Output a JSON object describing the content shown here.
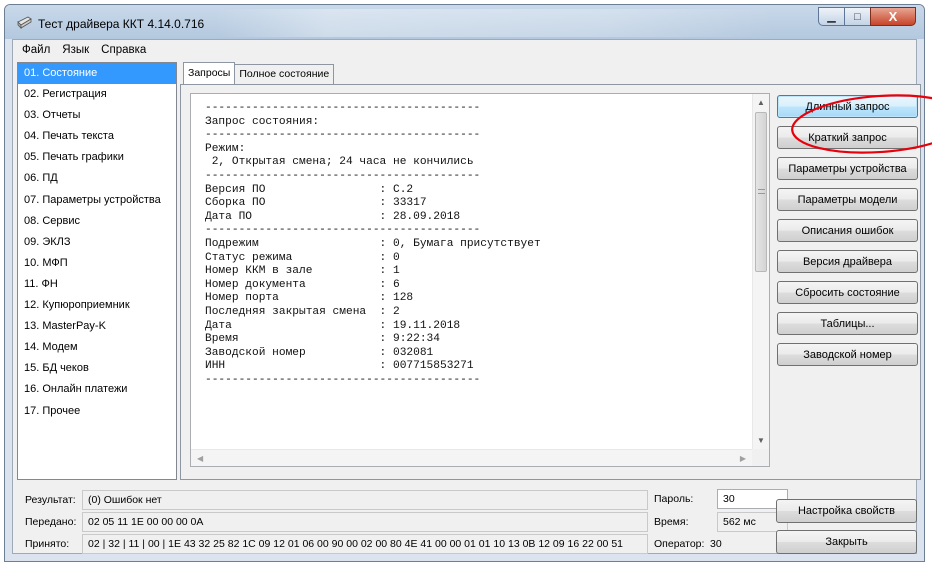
{
  "window": {
    "title": "Тест драйвера ККТ 4.14.0.716",
    "minimize_glyph": "▁",
    "maximize_glyph": "□",
    "close_glyph": "X"
  },
  "menu": [
    "Файл",
    "Язык",
    "Справка"
  ],
  "sidebar": {
    "items": [
      "01. Состояние",
      "02. Регистрация",
      "03. Отчеты",
      "04. Печать текста",
      "05. Печать графики",
      "06. ПД",
      "07. Параметры устройства",
      "08. Сервис",
      "09. ЭКЛЗ",
      "10. МФП",
      "11. ФН",
      "12. Купюроприемник",
      "13. MasterPay-K",
      "14. Модем",
      "15. БД чеков",
      "16. Онлайн платежи",
      "17. Прочее"
    ],
    "selected_index": 0
  },
  "tabs": [
    "Запросы",
    "Полное состояние"
  ],
  "output_text": [
    "-----------------------------------------",
    "Запрос состояния:",
    "-----------------------------------------",
    "Режим:",
    " 2, Открытая смена; 24 часа не кончились",
    "-----------------------------------------",
    "Версия ПО                 : C.2",
    "Сборка ПО                 : 33317",
    "Дата ПО                   : 28.09.2018",
    "-----------------------------------------",
    "Подрежим                  : 0, Бумага присутствует",
    "Статус режима             : 0",
    "Номер ККМ в зале          : 1",
    "Номер документа           : 6",
    "Номер порта               : 128",
    "Последняя закрытая смена  : 2",
    "Дата                      : 19.11.2018",
    "Время                     : 9:22:34",
    "Заводской номер           : 032081",
    "ИНН                       : 007715853271",
    "-----------------------------------------"
  ],
  "buttons": {
    "long_request": "Длинный запрос",
    "short_request": "Краткий запрос",
    "device_params": "Параметры устройства",
    "model_params": "Параметры модели",
    "error_descriptions": "Описания ошибок",
    "driver_version": "Версия драйвера",
    "reset_state": "Сбросить состояние",
    "tables": "Таблицы...",
    "serial_number": "Заводской номер",
    "settings": "Настройка свойств",
    "close": "Закрыть"
  },
  "status": {
    "result_label": "Результат:",
    "result_value": "(0) Ошибок нет",
    "sent_label": "Передано:",
    "sent_value": "02 05 11 1E 00 00 00 0A",
    "received_label": "Принято:",
    "received_value": "02 | 32 | 11 | 00 | 1E 43 32 25 82 1C 09 12 01 06 00 90 00 02 00 80 4E 41 00 00 01 01 10 13 0B 12 09 16 22 00 51",
    "password_label": "Пароль:",
    "password_value": "30",
    "time_label": "Время:",
    "time_value": "562 мс",
    "operator_label": "Оператор:",
    "operator_value": "30"
  },
  "colors": {
    "selection": "#3399ff",
    "annotation": "#e8000b"
  }
}
